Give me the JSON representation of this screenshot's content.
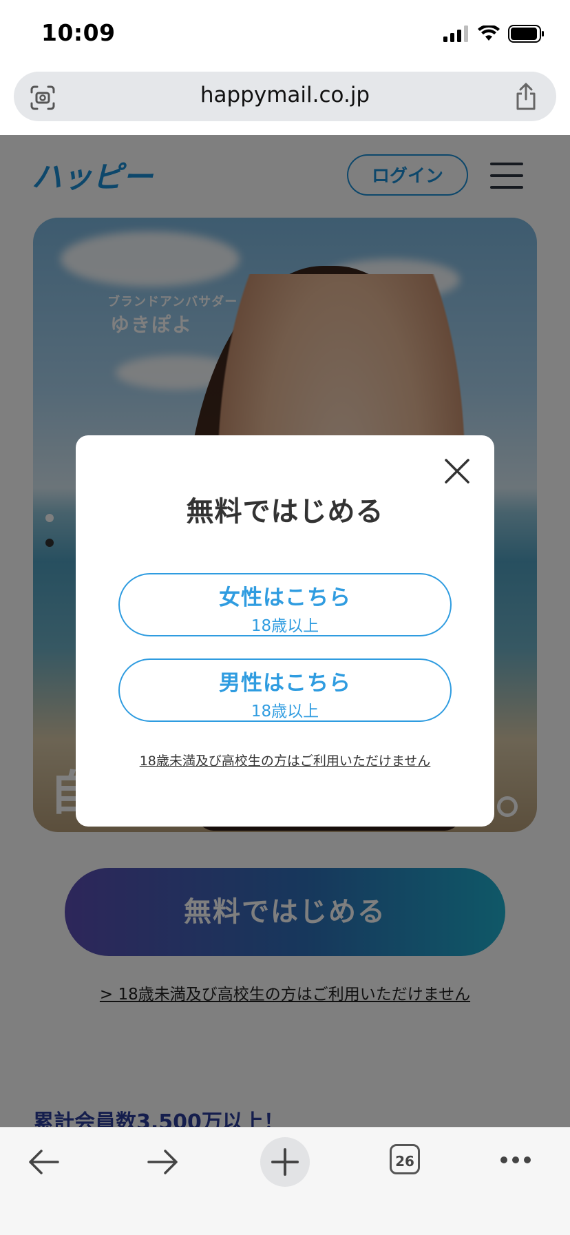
{
  "status_bar": {
    "time": "10:09"
  },
  "url_bar": {
    "url": "happymail.co.jp"
  },
  "header": {
    "logo_text": "ハッピー",
    "login_label": "ログイン"
  },
  "hero": {
    "ambassador_label": "ブランドアンバサダー",
    "ambassador_name": "ゆきぽよ",
    "partial_text": "自"
  },
  "cta": {
    "label": "無料ではじめる"
  },
  "page_notice": "> 18歳未満及び高校生の方はご利用いただけません",
  "member_count": "累計会員数3,500万以上！",
  "modal": {
    "title": "無料ではじめる",
    "female": {
      "label": "女性はこちら",
      "sub": "18歳以上"
    },
    "male": {
      "label": "男性はこちら",
      "sub": "18歳以上"
    },
    "notice": "18歳未満及び高校生の方はご利用いただけません"
  },
  "toolbar": {
    "tab_count": "26"
  },
  "colors": {
    "accent": "#2f9ce0",
    "login_blue": "#1b8fd6",
    "cta_start": "#5b4db4",
    "cta_end": "#1fb0cf"
  }
}
